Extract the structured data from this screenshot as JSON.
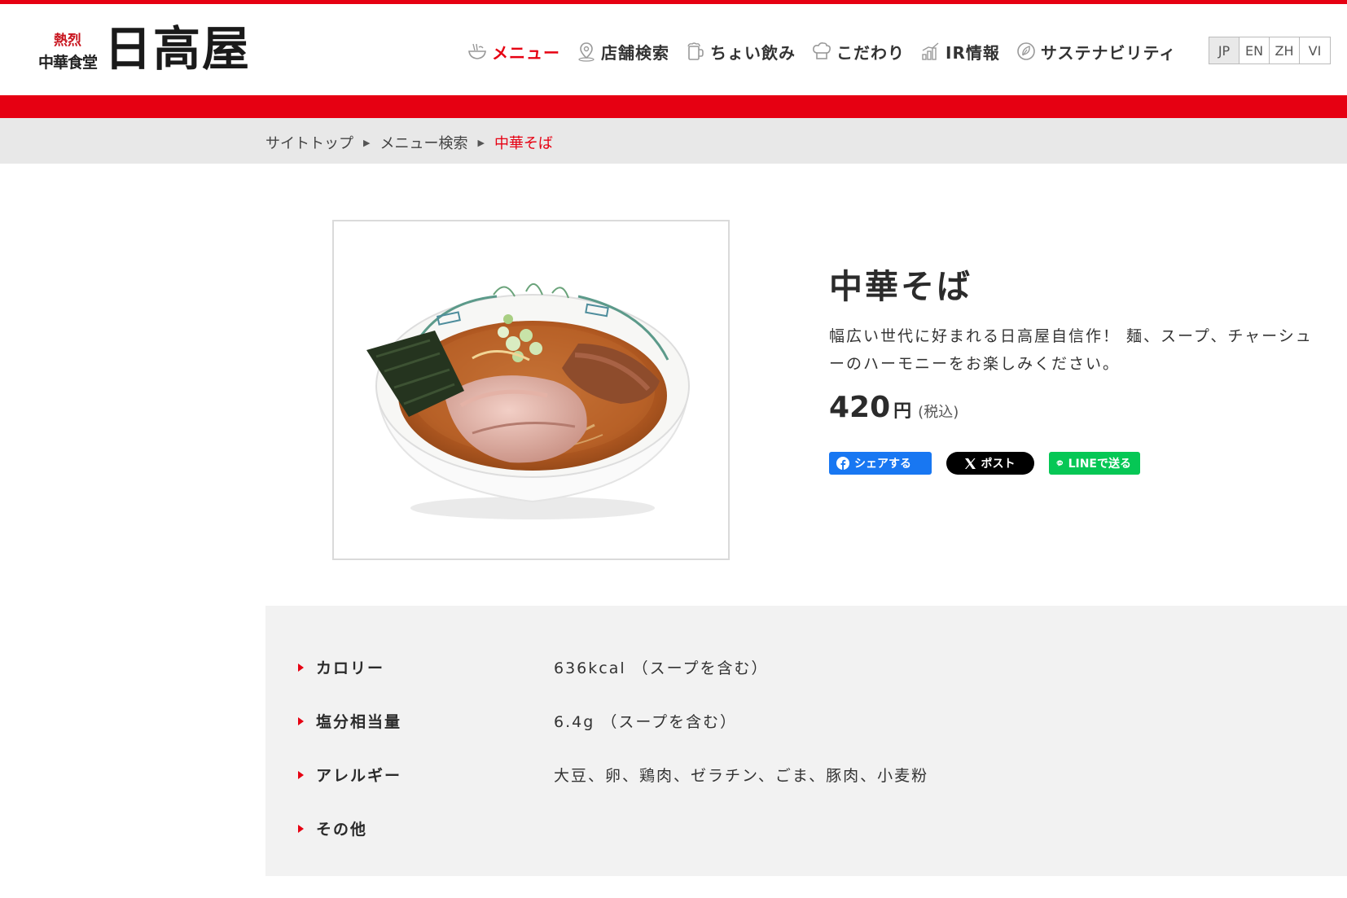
{
  "logo": {
    "top_text": "熱烈",
    "sub_text": "中華食堂",
    "main_text": "日高屋"
  },
  "nav": [
    {
      "label": "メニュー",
      "icon": "ramen-bowl-icon"
    },
    {
      "label": "店舗検索",
      "icon": "map-pin-icon"
    },
    {
      "label": "ちょい飲み",
      "icon": "beer-mug-icon"
    },
    {
      "label": "こだわり",
      "icon": "chef-hat-icon"
    },
    {
      "label": "IR情報",
      "icon": "bar-chart-icon"
    },
    {
      "label": "サステナビリティ",
      "icon": "leaf-circle-icon"
    }
  ],
  "languages": [
    "JP",
    "EN",
    "ZH",
    "VI"
  ],
  "breadcrumb": {
    "home": "サイトトップ",
    "search": "メニュー検索",
    "current": "中華そば"
  },
  "product": {
    "name": "中華そば",
    "description": "幅広い世代に好まれる日高屋自信作！ 麺、スープ、チャーシューのハーモニーをお楽しみください。",
    "price": "420",
    "currency": "円",
    "tax_note": "(税込)"
  },
  "share": {
    "facebook": "シェアする",
    "x": "ポスト",
    "line": "LINEで送る"
  },
  "nutrition": [
    {
      "label": "カロリー",
      "value": "636kcal （スープを含む）"
    },
    {
      "label": "塩分相当量",
      "value": "6.4g （スープを含む）"
    },
    {
      "label": "アレルギー",
      "value": "大豆、卵、鶏肉、ゼラチン、ごま、豚肉、小麦粉"
    },
    {
      "label": "その他",
      "value": ""
    }
  ],
  "colors": {
    "brand_red": "#e60012",
    "facebook": "#1877f2",
    "line": "#06c755"
  }
}
